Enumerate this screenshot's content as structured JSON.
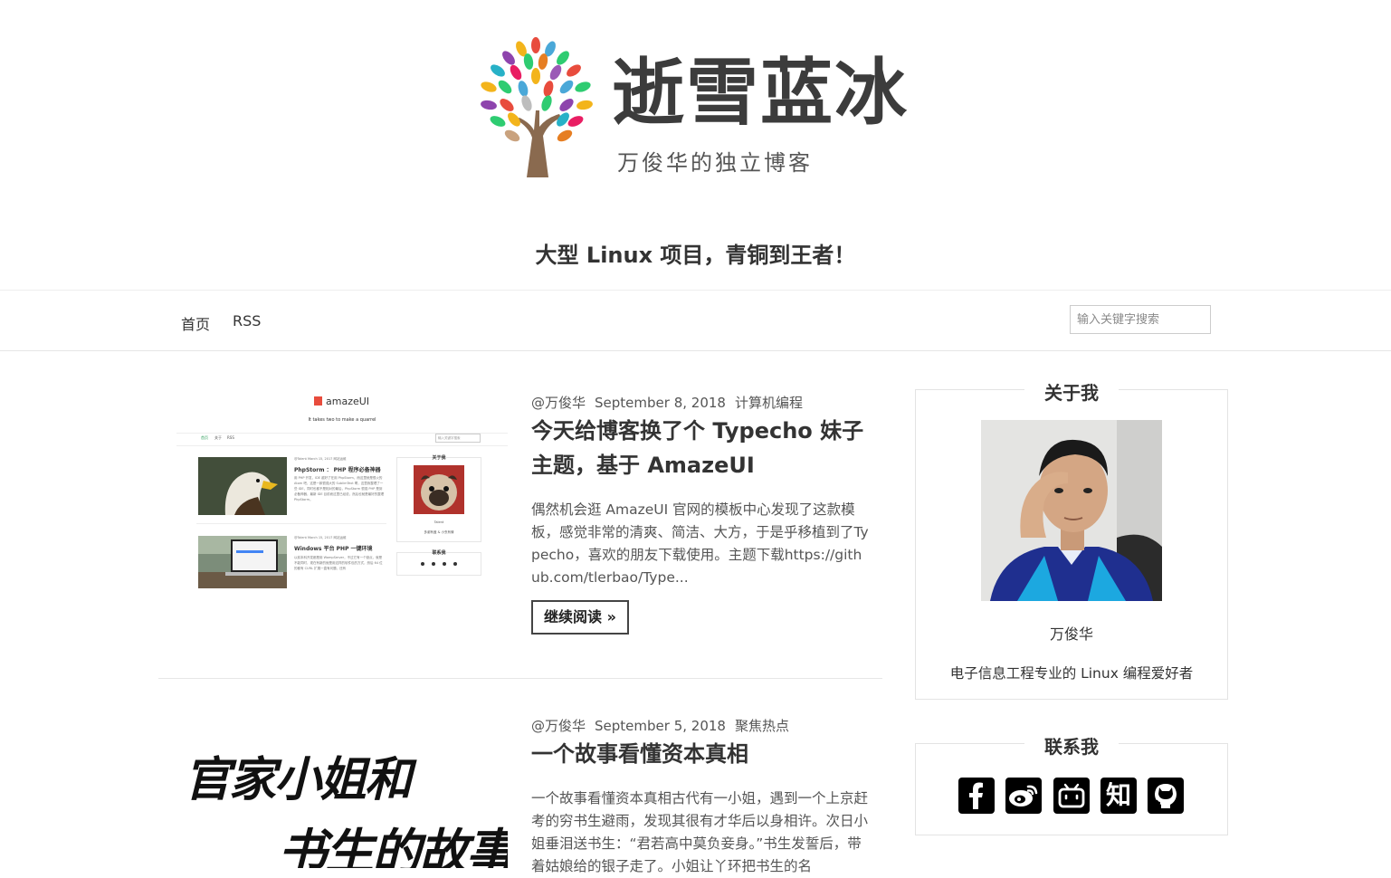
{
  "site": {
    "logo_title": "逝雪蓝冰",
    "logo_subtitle": "万俊华的独立博客",
    "description": "大型 Linux 项目，青铜到王者！"
  },
  "nav": {
    "items": [
      {
        "label": "首页"
      },
      {
        "label": "RSS"
      }
    ],
    "search_placeholder": "输入关键字搜索"
  },
  "posts": [
    {
      "author": "@万俊华",
      "date": "September 8, 2018",
      "category": "计算机编程",
      "title": "今天给博客换了个 Typecho 妹子主题，基于 AmazeUI",
      "excerpt": "偶然机会逛 AmazeUI 官网的模板中心发现了这款模板，感觉非常的清爽、简洁、大方，于是乎移植到了Typecho，喜欢的朋友下载使用。主题下载https://github.com/tlerbao/Type...",
      "read_more": "继续阅读 »",
      "thumb": {
        "brand": "amazeUI",
        "tagline": "It takes two to make a quarrel",
        "nav": [
          "首页",
          "关于",
          "RSS"
        ],
        "search": "输入关键字搜索",
        "item1_meta": "@Talent   March 15, 2017 网站运维",
        "item1_title": "PhpStorm ： PHP 程序必备神器",
        "item1_text": "用 PHP 开发，IDE 越好了在用 PhpStorm，而这里就是很火的 Atom 吧，这是一款很强大的 SublimText 啊，这里我整理了一些 IDE，同时也都不是相对的最后，PhpStorm 很强 PHP 是到必备神器，最新 IDE 目前而这里已经说，然后也就是最好的整理 PhpStorm。",
        "item2_meta": "@Talent   March 15, 2017 网站运维",
        "item2_title": "Windows 平台 PHP 一键环境",
        "item2_text": "以前本科开发都是用 WampServer，不过它有一个缺点，就是不能同时，现在有新的就是用这样的软件包的方式，然后 64 位的都有 CURL 扩展一直有问题，还有",
        "about": "关于我",
        "about_name": "Talent",
        "about_text": "多谢有盖 & 小虫有情",
        "contact": "联系我"
      }
    },
    {
      "author": "@万俊华",
      "date": "September 5, 2018",
      "category": "聚焦热点",
      "title": "一个故事看懂资本真相",
      "excerpt": "一个故事看懂资本真相古代有一小姐，遇到一个上京赶考的穷书生避雨，发现其很有才华后以身相许。次日小姐垂泪送书生：“君若高中莫负妾身。”书生发誓后，带着姑娘给的银子走了。小姐让丫环把书生的名",
      "thumb": {
        "line1": "官家小姐和",
        "line2": "书生的故事"
      }
    }
  ],
  "sidebar": {
    "about": {
      "title": "关于我",
      "name": "万俊华",
      "bio": "电子信息工程专业的 Linux 编程爱好者"
    },
    "contact": {
      "title": "联系我",
      "links": [
        {
          "icon": "facebook-icon"
        },
        {
          "icon": "weibo-icon"
        },
        {
          "icon": "bilibili-icon"
        },
        {
          "icon": "zhihu-icon",
          "glyph": "知"
        },
        {
          "icon": "github-icon"
        }
      ]
    }
  }
}
